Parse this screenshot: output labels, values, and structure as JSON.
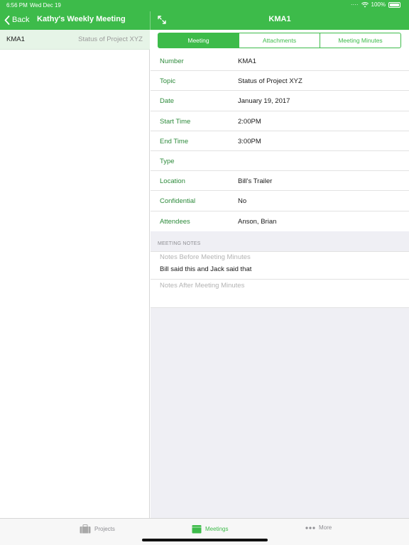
{
  "status_bar": {
    "time": "6:56 PM",
    "date": "Wed Dec 19",
    "battery": "100%"
  },
  "nav": {
    "back_label": "Back",
    "left_title": "Kathy's Weekly Meeting",
    "right_title": "KMA1"
  },
  "colors": {
    "accent": "#3dbb4a",
    "label_green": "#2e8b3c",
    "selected_row": "#e6f4e7"
  },
  "left_list": {
    "items": [
      {
        "number": "KMA1",
        "topic": "Status of Project XYZ"
      }
    ]
  },
  "segments": {
    "meeting": "Meeting",
    "attachments": "Attachments",
    "minutes": "Meeting Minutes",
    "selected": "Meeting"
  },
  "fields": [
    {
      "label": "Number",
      "value": "KMA1"
    },
    {
      "label": "Topic",
      "value": "Status of Project XYZ"
    },
    {
      "label": "Date",
      "value": "January 19, 2017"
    },
    {
      "label": "Start Time",
      "value": "2:00PM"
    },
    {
      "label": "End Time",
      "value": "3:00PM"
    },
    {
      "label": "Type",
      "value": ""
    },
    {
      "label": "Location",
      "value": "Bill's Trailer"
    },
    {
      "label": "Confidential",
      "value": "No"
    },
    {
      "label": "Attendees",
      "value": "Anson, Brian"
    }
  ],
  "notes": {
    "header": "MEETING NOTES",
    "before_placeholder": "Notes Before Meeting Minutes",
    "before_text": "Bill said this and Jack said that",
    "after_placeholder": "Notes After Meeting Minutes"
  },
  "tabbar": {
    "projects": "Projects",
    "meetings": "Meetings",
    "more": "More",
    "icons": {
      "projects": "briefcase-icon",
      "meetings": "calendar-icon",
      "more": "ellipsis-icon"
    }
  }
}
